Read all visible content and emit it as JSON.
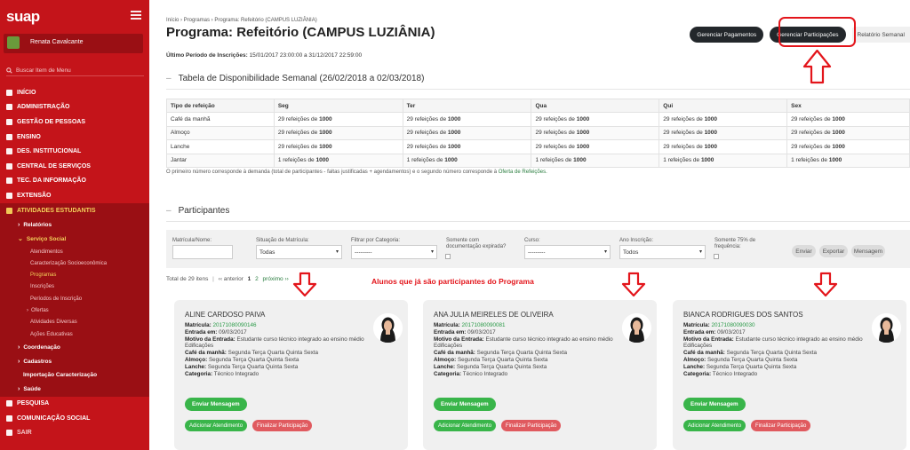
{
  "sidebar": {
    "brand": "suap",
    "user_name": "Renata Cavalcante",
    "search_placeholder": "Buscar Item de Menu",
    "menu": [
      {
        "label": "INÍCIO"
      },
      {
        "label": "ADMINISTRAÇÃO"
      },
      {
        "label": "GESTÃO DE PESSOAS"
      },
      {
        "label": "ENSINO"
      },
      {
        "label": "DES. INSTITUCIONAL"
      },
      {
        "label": "CENTRAL DE SERVIÇOS"
      },
      {
        "label": "TEC. DA INFORMAÇÃO"
      },
      {
        "label": "EXTENSÃO"
      },
      {
        "label": "ATIVIDADES ESTUDANTIS"
      }
    ],
    "sub_relatorios": "Relatórios",
    "sub_servico_social": "Serviço Social",
    "subsub": [
      "Atendimentos",
      "Caracterização Socioeconômica",
      "Programas",
      "Inscrições",
      "Períodos de Inscrição",
      "Ofertas",
      "Atividades Diversas",
      "Ações Educativas"
    ],
    "sub_coordenacao": "Coordenação",
    "sub_cadastros": "Cadastros",
    "sub_importacao": "Importação Caracterização",
    "sub_saude": "Saúde",
    "menu2": [
      {
        "label": "PESQUISA"
      },
      {
        "label": "COMUNICAÇÃO SOCIAL"
      },
      {
        "label": "SAIR"
      }
    ]
  },
  "breadcrumb": "Início  ›  Programas  ›  Programa: Refeitório (CAMPUS LUZIÂNIA)",
  "page_title": "Programa: Refeitório (CAMPUS LUZIÂNIA)",
  "actions": {
    "gerenciar_pagamentos": "Gerenciar Pagamentos",
    "gerenciar_participacoes": "Gerenciar Participações",
    "relatorio_semanal": "Relatório Semanal"
  },
  "last_period": {
    "label": "Último Período de Inscrições:",
    "value": "15/01/2017 23:00:00 a 31/12/2017 22:59:00"
  },
  "availability": {
    "title": "Tabela de Disponibilidade Semanal (26/02/2018 a 02/03/2018)",
    "headers": [
      "Tipo de refeição",
      "Seg",
      "Ter",
      "Qua",
      "Qui",
      "Sex"
    ],
    "rows": [
      {
        "type": "Café da manhã",
        "cells": [
          [
            "29 refeições de ",
            "1000"
          ],
          [
            "29 refeições de ",
            "1000"
          ],
          [
            "29 refeições de ",
            "1000"
          ],
          [
            "29 refeições de ",
            "1000"
          ],
          [
            "29 refeições de ",
            "1000"
          ]
        ]
      },
      {
        "type": "Almoço",
        "cells": [
          [
            "29 refeições de ",
            "1000"
          ],
          [
            "29 refeições de ",
            "1000"
          ],
          [
            "29 refeições de ",
            "1000"
          ],
          [
            "29 refeições de ",
            "1000"
          ],
          [
            "29 refeições de ",
            "1000"
          ]
        ]
      },
      {
        "type": "Lanche",
        "cells": [
          [
            "29 refeições de ",
            "1000"
          ],
          [
            "29 refeições de ",
            "1000"
          ],
          [
            "29 refeições de ",
            "1000"
          ],
          [
            "29 refeições de ",
            "1000"
          ],
          [
            "29 refeições de ",
            "1000"
          ]
        ]
      },
      {
        "type": "Jantar",
        "cells": [
          [
            "1 refeições de ",
            "1000"
          ],
          [
            "1 refeições de ",
            "1000"
          ],
          [
            "1 refeições de ",
            "1000"
          ],
          [
            "1 refeições de ",
            "1000"
          ],
          [
            "1 refeições de ",
            "1000"
          ]
        ]
      }
    ],
    "note": "O primeiro número corresponde à demanda (total de participantes - faltas justificadas + agendamentos) e o segundo número corresponde à",
    "note_link": "Oferta de Refeições."
  },
  "participants": {
    "title": "Participantes",
    "filters": {
      "matricula_label": "Matrícula/Nome:",
      "situacao_label": "Situação de Matrícula:",
      "situacao_value": "Todas",
      "categoria_label": "Filtrar por Categoria:",
      "categoria_value": "---------",
      "doc_label": "Somente com documentação expirada?",
      "curso_label": "Curso:",
      "curso_value": "---------",
      "ano_label": "Ano Inscrição:",
      "ano_value": "Todos",
      "freq_label": "Somente 75% de frequência:",
      "enviar": "Enviar",
      "exportar": "Exportar",
      "mensagem": "Mensagem"
    },
    "total": "Total de 29 itens",
    "pagination": {
      "anterior": "‹‹ anterior",
      "page1": "1",
      "page2": "2",
      "proximo": "próximo ››"
    },
    "annotation": "Alunos que já são participantes do Programa",
    "cards": [
      {
        "name": "ALINE CARDOSO PAIVA",
        "matricula": "20171080090146",
        "entrada": "09/03/2017",
        "motivo": "Estudante curso técnico integrado ao ensino médio",
        "motivo2": "Edificações",
        "cafe": "Segunda Terça Quarta Quinta Sexta",
        "almoco": "Segunda Terça Quarta Quinta Sexta",
        "lanche": "Segunda Terça Quarta Quinta Sexta",
        "categoria": "Técnico Integrado"
      },
      {
        "name": "ANA JULIA MEIRELES DE OLIVEIRA",
        "matricula": "20171080090081",
        "entrada": "09/03/2017",
        "motivo": "Estudante curso técnico integrado ao ensino médio",
        "motivo2": "Edificações",
        "cafe": "Segunda Terça Quarta Quinta Sexta",
        "almoco": "Segunda Terça Quarta Quinta Sexta",
        "lanche": "Segunda Terça Quarta Quinta Sexta",
        "categoria": "Técnico Integrado"
      },
      {
        "name": "BIANCA RODRIGUES DOS SANTOS",
        "matricula": "20171080090030",
        "entrada": "09/03/2017",
        "motivo": "Estudante curso técnico integrado ao ensino médio",
        "motivo2": "Edificações",
        "cafe": "Segunda Terça Quarta Quinta Sexta",
        "almoco": "Segunda Terça Quarta Quinta Sexta",
        "lanche": "Segunda Terça Quarta Quinta Sexta",
        "categoria": "Técnico Integrado"
      }
    ],
    "field_labels": {
      "matricula": "Matrícula:",
      "entrada": "Entrada em:",
      "motivo": "Motivo da Entrada:",
      "cafe": "Café da manhã:",
      "almoco": "Almoço:",
      "lanche": "Lanche:",
      "categoria": "Categoria:"
    },
    "card_buttons": {
      "enviar_mensagem": "Enviar Mensagem",
      "adicionar_atendimento": "Adicionar Atendimento",
      "finalizar_participacao": "Finalizar Participação"
    }
  },
  "colors": {
    "sidebar_red": "#c4141a",
    "sidebar_dark": "#9a0f14",
    "highlight": "#f4d35b",
    "annotation_red": "#e3151b",
    "green": "#39b54a"
  }
}
